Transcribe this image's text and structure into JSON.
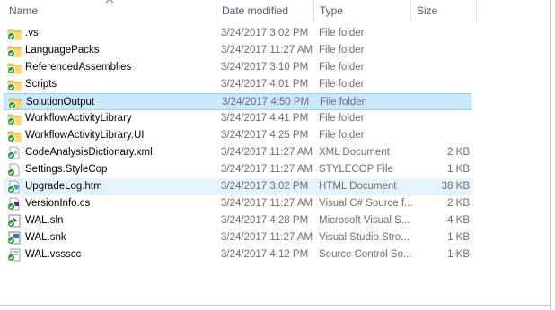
{
  "columns": {
    "name": "Name",
    "date_modified": "Date modified",
    "type": "Type",
    "size": "Size"
  },
  "files": [
    {
      "name": ".vs",
      "date": "3/24/2017 3:02 PM",
      "type": "File folder",
      "size": "",
      "icon": "folder-icon"
    },
    {
      "name": "LanguagePacks",
      "date": "3/24/2017 11:27 AM",
      "type": "File folder",
      "size": "",
      "icon": "folder-icon"
    },
    {
      "name": "ReferencedAssemblies",
      "date": "3/24/2017 3:10 PM",
      "type": "File folder",
      "size": "",
      "icon": "folder-icon"
    },
    {
      "name": "Scripts",
      "date": "3/24/2017 4:01 PM",
      "type": "File folder",
      "size": "",
      "icon": "folder-icon"
    },
    {
      "name": "SolutionOutput",
      "date": "3/24/2017 4:50 PM",
      "type": "File folder",
      "size": "",
      "icon": "folder-icon"
    },
    {
      "name": "WorkflowActivityLibrary",
      "date": "3/24/2017 4:41 PM",
      "type": "File folder",
      "size": "",
      "icon": "folder-icon"
    },
    {
      "name": "WorkflowActivityLibrary.UI",
      "date": "3/24/2017 4:25 PM",
      "type": "File folder",
      "size": "",
      "icon": "folder-icon"
    },
    {
      "name": "CodeAnalysisDictionary.xml",
      "date": "3/24/2017 11:27 AM",
      "type": "XML Document",
      "size": "2 KB",
      "icon": "xml-file-icon"
    },
    {
      "name": "Settings.StyleCop",
      "date": "3/24/2017 11:27 AM",
      "type": "STYLECOP File",
      "size": "1 KB",
      "icon": "generic-file-icon"
    },
    {
      "name": "UpgradeLog.htm",
      "date": "3/24/2017 3:02 PM",
      "type": "HTML Document",
      "size": "38 KB",
      "icon": "html-file-icon"
    },
    {
      "name": "VersionInfo.cs",
      "date": "3/24/2017 11:27 AM",
      "type": "Visual C# Source f...",
      "size": "2 KB",
      "icon": "csharp-file-icon"
    },
    {
      "name": "WAL.sln",
      "date": "3/24/2017 4:28 PM",
      "type": "Microsoft Visual S...",
      "size": "4 KB",
      "icon": "solution-file-icon"
    },
    {
      "name": "WAL.snk",
      "date": "3/24/2017 11:27 AM",
      "type": "Visual Studio Stro...",
      "size": "1 KB",
      "icon": "snk-file-icon"
    },
    {
      "name": "WAL.vssscc",
      "date": "3/24/2017 4:12 PM",
      "type": "Source Control So...",
      "size": "1 KB",
      "icon": "source-control-file-icon"
    }
  ],
  "selected_index": 4,
  "hover_index": 9,
  "status_colors": {
    "checkin_badge": "#22a339",
    "folder": "#f2c55c",
    "selection": "#cce8ff"
  }
}
